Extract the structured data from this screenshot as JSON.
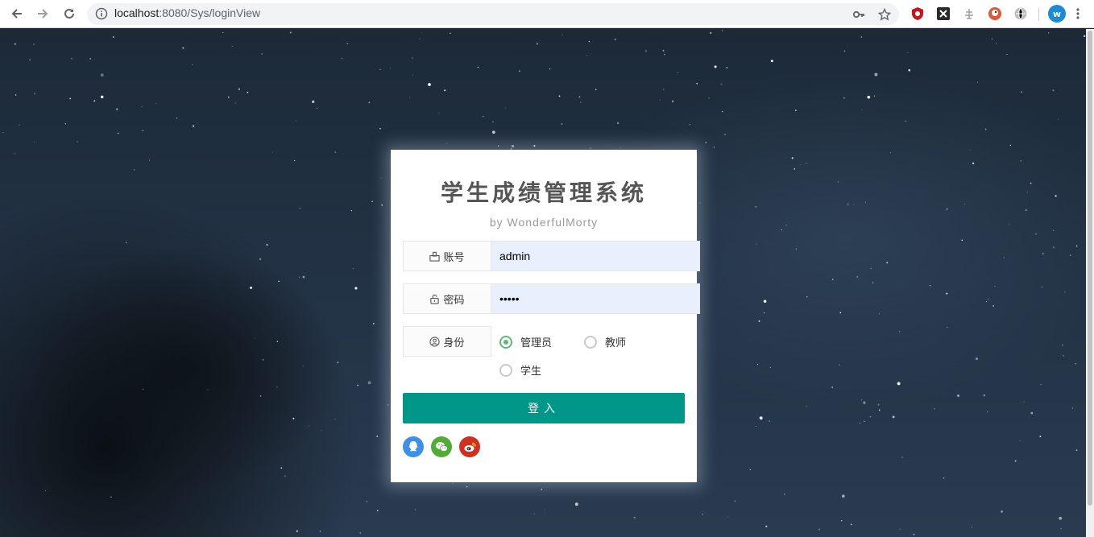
{
  "browser": {
    "url_host": "localhost",
    "url_rest": ":8080/Sys/loginView",
    "avatar_letter": "w"
  },
  "login": {
    "title": "学生成绩管理系统",
    "subtitle": "by WonderfulMorty",
    "account_label": "账号",
    "account_value": "admin",
    "password_label": "密码",
    "password_value": "admin",
    "role_label": "身份",
    "roles": [
      {
        "label": "管理员",
        "checked": true
      },
      {
        "label": "教师",
        "checked": false
      },
      {
        "label": "学生",
        "checked": false
      }
    ],
    "submit_label": "登入"
  },
  "colors": {
    "primary": "#009688",
    "radio_checked": "#5fb878",
    "qq": "#3d8fe8",
    "wechat": "#4fad34",
    "weibo": "#d1301e"
  }
}
